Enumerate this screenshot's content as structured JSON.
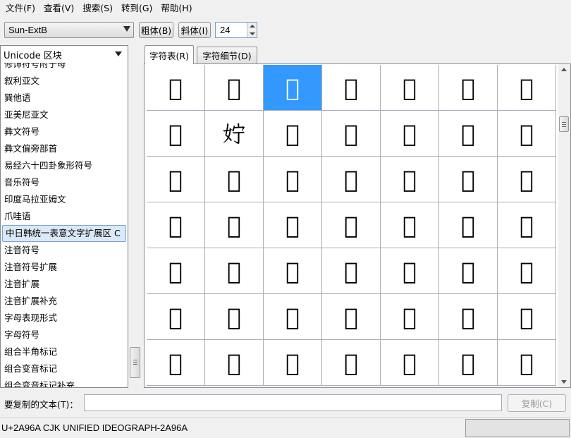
{
  "menu": [
    "文件(F)",
    "查看(V)",
    "搜索(S)",
    "转到(G)",
    "帮助(H)"
  ],
  "toolbar": {
    "font": "Sun-ExtB",
    "bold_label": "粗体(B)",
    "italic_label": "斜体(I)",
    "size": "24"
  },
  "sidebar": {
    "dropdown_label": "Unicode 区块",
    "items": [
      "修饰符号附子母",
      "叙利亚文",
      "巽他语",
      "亚美尼亚文",
      "彝文符号",
      "彝文偏旁部首",
      "易经六十四卦象形符号",
      "音乐符号",
      "印度马拉亚姆文",
      "爪哇语",
      "中日韩统一表意文字扩展区 C",
      "注音符号",
      "注音符号扩展",
      "注音扩展",
      "注音扩展补充",
      "字母表现形式",
      "字母符号",
      "组合半角标记",
      "组合变音标记",
      "组合变音标记补充"
    ],
    "selected_index": 10
  },
  "tabs": [
    "字符表(R)",
    "字符细节(D)"
  ],
  "grid": {
    "chars": [
      "𪥨",
      "𪥩",
      "𪥪",
      "𪥫",
      "𪥬",
      "𪥭",
      "𪥮",
      "𪥯",
      "𪥰",
      "𪥱",
      "𪥲",
      "𪥳",
      "𪥴",
      "𪥵",
      "𪥶",
      "𪥷",
      "𪥸",
      "𪥹",
      "𪥺",
      "𪥻",
      "𪥼",
      "𪥽",
      "𪥾",
      "𪥿",
      "𪦀",
      "𪦁",
      "𪦂",
      "𪦃",
      "𪦄",
      "𪦅",
      "𪦆",
      "𪦇",
      "𪦈",
      "𪦉",
      "𪦊",
      "𪦋",
      "𪦌",
      "𪦍",
      "𪦎",
      "𪦏",
      "𪦐",
      "𪦑",
      "𪦒",
      "𪦓",
      "𪦔",
      "𪦕",
      "𪦖",
      "𪦗",
      "𪦘"
    ],
    "selected_index": 2
  },
  "copy": {
    "label": "要复制的文本(T)：",
    "value": "",
    "button": "复制(C)"
  },
  "status": {
    "text": "U+2A96A CJK UNIFIED IDEOGRAPH-2A96A"
  }
}
